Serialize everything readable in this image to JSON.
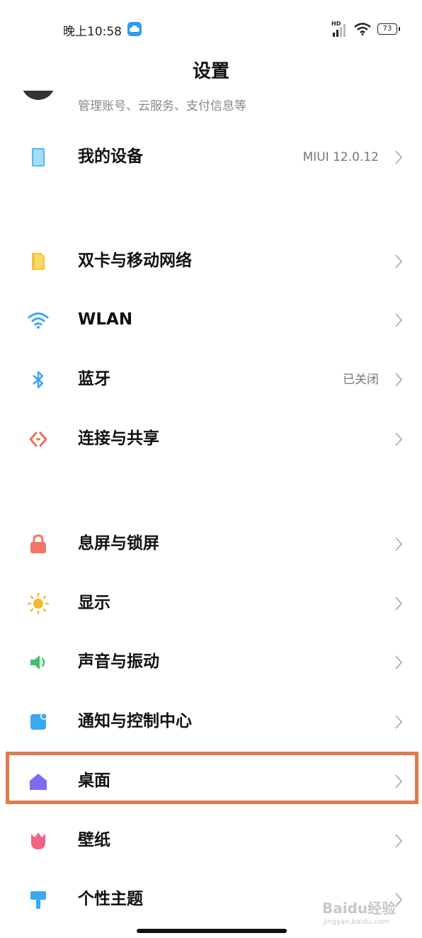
{
  "status_bar": {
    "time": "晚上10:58",
    "network_badge": "HD",
    "battery": "73"
  },
  "page": {
    "title": "设置"
  },
  "account": {
    "subtitle": "管理账号、云服务、支付信息等"
  },
  "rows": {
    "my_device": {
      "label": "我的设备",
      "value": "MIUI 12.0.12",
      "icon": "tablet-icon",
      "color": "#4fb8f0"
    },
    "sim": {
      "label": "双卡与移动网络",
      "icon": "sim-card-icon",
      "color": "#f5c33b"
    },
    "wlan": {
      "label": "WLAN",
      "icon": "wifi-icon",
      "color": "#3aa9f0"
    },
    "bluetooth": {
      "label": "蓝牙",
      "value": "已关闭",
      "icon": "bluetooth-icon",
      "color": "#3aa9f0"
    },
    "connect": {
      "label": "连接与共享",
      "icon": "connection-share-icon",
      "color": "#e8735a"
    },
    "lock": {
      "label": "息屏与锁屏",
      "icon": "lock-icon",
      "color": "#f27566"
    },
    "display": {
      "label": "显示",
      "icon": "sun-icon",
      "color": "#f5b72e"
    },
    "sound": {
      "label": "声音与振动",
      "icon": "speaker-icon",
      "color": "#3fc46a"
    },
    "notifications": {
      "label": "通知与控制中心",
      "icon": "notification-icon",
      "color": "#3aa9f0"
    },
    "desktop": {
      "label": "桌面",
      "icon": "home-icon",
      "color": "#7b6cf0"
    },
    "wallpaper": {
      "label": "壁纸",
      "icon": "tulip-icon",
      "color": "#f06482"
    },
    "theme": {
      "label": "个性主题",
      "icon": "paint-brush-icon",
      "color": "#3aa9f0"
    }
  },
  "watermark": {
    "text": "Baidu经验",
    "sub": "jingyan.baidu.com"
  },
  "colors": {
    "highlight": "#e07b4c",
    "chevron": "#b5b5b5"
  }
}
